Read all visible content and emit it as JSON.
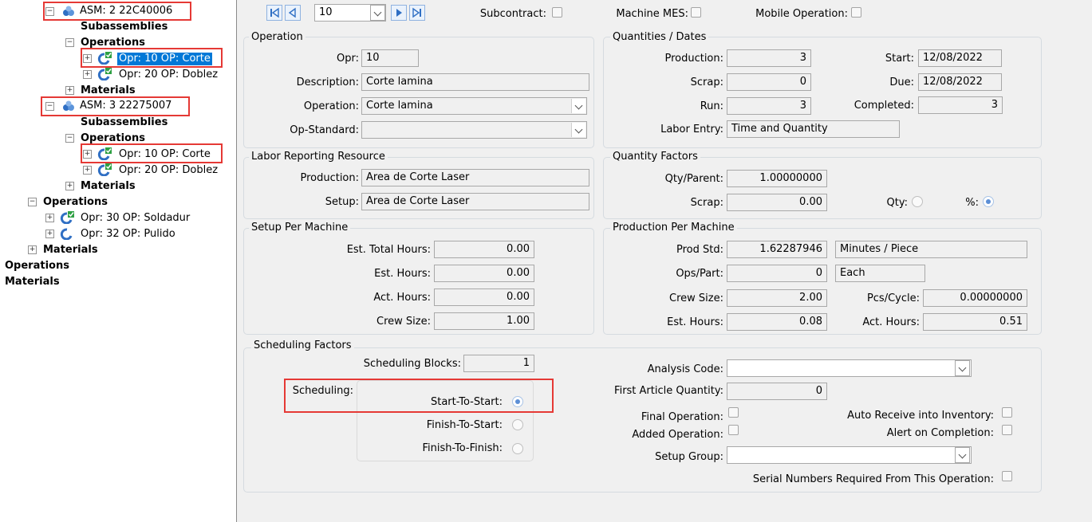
{
  "tree": {
    "asm2": "ASM: 2 22C40006",
    "subassemblies1": "Subassemblies",
    "operations1": "Operations",
    "opr10_a": "Opr: 10 OP: Corte",
    "opr20_a": "Opr: 20 OP: Doblez",
    "materials1": "Materials",
    "asm3": "ASM: 3 22275007",
    "subassemblies2": "Subassemblies",
    "operations2": "Operations",
    "opr10_b": "Opr: 10 OP: Corte",
    "opr20_b": "Opr: 20 OP: Doblez",
    "materials2": "Materials",
    "operations3": "Operations",
    "opr30": "Opr: 30 OP: Soldadur",
    "opr32": "Opr: 32 OP: Pulido",
    "materials3": "Materials",
    "operations4": "Operations",
    "materials4": "Materials"
  },
  "toolbar": {
    "nav_value": "10",
    "subcontract_label": "Subcontract:",
    "machine_mes_label": "Machine MES:",
    "mobile_operation_label": "Mobile Operation:"
  },
  "operation": {
    "title": "Operation",
    "opr_label": "Opr:",
    "opr_value": "10",
    "description_label": "Description:",
    "description_value": "Corte lamina",
    "operation_label": "Operation:",
    "operation_value": "Corte lamina",
    "opstandard_label": "Op-Standard:",
    "opstandard_value": ""
  },
  "quantities": {
    "title": "Quantities / Dates",
    "production_label": "Production:",
    "production_value": "3",
    "scrap_label": "Scrap:",
    "scrap_value": "0",
    "run_label": "Run:",
    "run_value": "3",
    "labor_entry_label": "Labor Entry:",
    "labor_entry_value": "Time and Quantity",
    "start_label": "Start:",
    "start_value": "12/08/2022",
    "due_label": "Due:",
    "due_value": "12/08/2022",
    "completed_label": "Completed:",
    "completed_value": "3"
  },
  "labor": {
    "title": "Labor Reporting Resource",
    "production_label": "Production:",
    "production_value": "Area de Corte Laser",
    "setup_label": "Setup:",
    "setup_value": "Area de Corte Laser"
  },
  "qfactors": {
    "title": "Quantity Factors",
    "qtyparent_label": "Qty/Parent:",
    "qtyparent_value": "1.00000000",
    "scrap_label": "Scrap:",
    "scrap_value": "0.00",
    "qty_label": "Qty:",
    "pct_label": "%:"
  },
  "setup": {
    "title": "Setup Per Machine",
    "est_total_label": "Est. Total Hours:",
    "est_total_value": "0.00",
    "est_hours_label": "Est. Hours:",
    "est_hours_value": "0.00",
    "act_hours_label": "Act. Hours:",
    "act_hours_value": "0.00",
    "crew_label": "Crew Size:",
    "crew_value": "1.00"
  },
  "prod": {
    "title": "Production Per Machine",
    "prodstd_label": "Prod Std:",
    "prodstd_value": "1.62287946",
    "prodstd_unit": "Minutes / Piece",
    "opspart_label": "Ops/Part:",
    "opspart_value": "0",
    "opspart_unit": "Each",
    "crew_label": "Crew Size:",
    "crew_value": "2.00",
    "pcscycle_label": "Pcs/Cycle:",
    "pcscycle_value": "0.00000000",
    "esthours_label": "Est. Hours:",
    "esthours_value": "0.08",
    "acthours_label": "Act. Hours:",
    "acthours_value": "0.51"
  },
  "sched": {
    "title": "Scheduling Factors",
    "blocks_label": "Scheduling Blocks:",
    "blocks_value": "1",
    "scheduling_label": "Scheduling:",
    "sts_label": "Start-To-Start:",
    "fts_label": "Finish-To-Start:",
    "ftf_label": "Finish-To-Finish:",
    "analysis_label": "Analysis Code:",
    "first_article_label": "First Article Quantity:",
    "first_article_value": "0",
    "final_op_label": "Final Operation:",
    "added_op_label": "Added Operation:",
    "auto_receive_label": "Auto Receive into Inventory:",
    "alert_label": "Alert on Completion:",
    "setup_group_label": "Setup Group:",
    "serial_label": "Serial Numbers Required From This Operation:"
  },
  "colors": {
    "selection": "#0078d7",
    "highlight": "#e53935",
    "panel_bg": "#f0f0f0"
  }
}
